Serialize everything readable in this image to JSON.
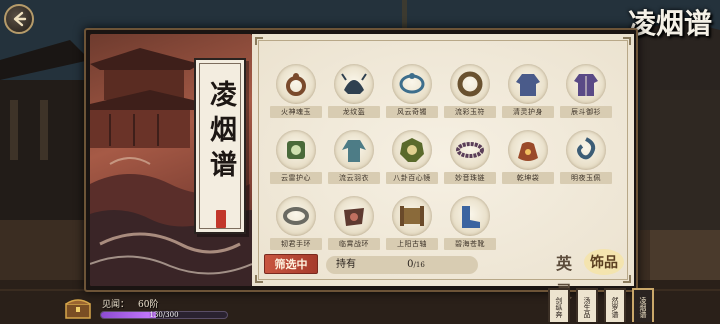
{
  "header": {
    "title": "凌烟谱"
  },
  "book": {
    "scroll_title": "凌烟谱",
    "items": [
      {
        "name": "火神魂玉",
        "icon": "amulet-icon",
        "color": "#7a4a2c"
      },
      {
        "name": "龙纹盔",
        "icon": "dragon-helm-icon",
        "color": "#2f4050"
      },
      {
        "name": "风云奇镯",
        "icon": "bracelet-icon",
        "color": "#3d6e8c"
      },
      {
        "name": "流彩玉符",
        "icon": "jade-ring-icon",
        "color": "#6a5230"
      },
      {
        "name": "清灵护身",
        "icon": "robe-icon",
        "color": "#4a5b8a"
      },
      {
        "name": "辰斗御衫",
        "icon": "armor-icon",
        "color": "#5a4a86"
      },
      {
        "name": "云雷护心",
        "icon": "mirror-icon",
        "color": "#4a6a3a"
      },
      {
        "name": "流云羽衣",
        "icon": "feather-robe-icon",
        "color": "#4d7c86"
      },
      {
        "name": "八卦百心镜",
        "icon": "bagua-icon",
        "color": "#5a6a2c"
      },
      {
        "name": "妙音珠链",
        "icon": "bead-chain-icon",
        "color": "#5a3e58"
      },
      {
        "name": "乾坤袋",
        "icon": "pouch-icon",
        "color": "#9a4a2a"
      },
      {
        "name": "明夜玉佩",
        "icon": "jade-pendant-icon",
        "color": "#3c5d76"
      },
      {
        "name": "韧君手环",
        "icon": "armband-icon",
        "color": "#6a6a62"
      },
      {
        "name": "临霄战环",
        "icon": "war-ring-icon",
        "color": "#5e3a30"
      },
      {
        "name": "上阳古轴",
        "icon": "scroll-icon",
        "color": "#8a6a3a"
      },
      {
        "name": "碧海苍靴",
        "icon": "boots-icon",
        "color": "#3b64a0"
      }
    ],
    "filter_label": "筛选中",
    "owned_label": "持有",
    "owned_count": "0",
    "owned_total": "/16",
    "stamp_1": "英灵",
    "stamp_2": "饰品"
  },
  "hud": {
    "exp_label": "见闻：",
    "exp_level": "60阶",
    "exp_current": 130,
    "exp_max": 300,
    "exp_text": "130/300"
  },
  "side_tabs": [
    {
      "label": "剑纵奔",
      "active": false
    },
    {
      "label": "汤生品",
      "active": false
    },
    {
      "label": "然罗谱",
      "active": false
    },
    {
      "label": "凌烟谱",
      "active": true
    }
  ],
  "colors": {
    "accent_red": "#c8553f",
    "exp_purple": "#c77cff",
    "paper": "#f1eadb"
  }
}
